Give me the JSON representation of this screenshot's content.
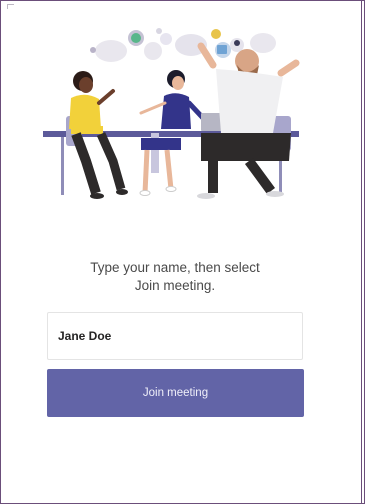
{
  "join_form": {
    "prompt_line1": "Type your name, then select",
    "prompt_line2": "Join meeting.",
    "name_value": "Jane Doe",
    "join_label": "Join meeting"
  },
  "illustration": {
    "icon": "people-meeting-at-table-illustration"
  },
  "colors": {
    "accent": "#6264a7",
    "border": "#6b4e7a",
    "prompt_text": "#4a4a4a"
  }
}
